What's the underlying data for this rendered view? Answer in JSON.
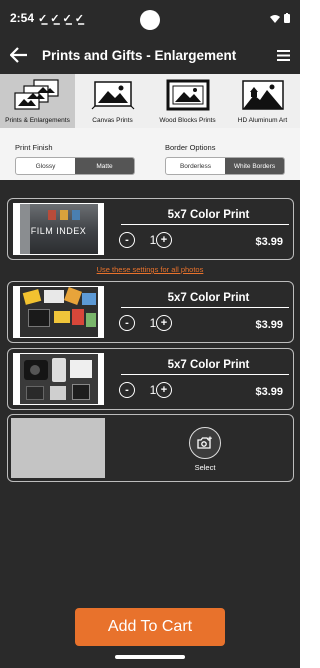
{
  "status": {
    "time": "2:54",
    "checks": [
      "✓̲",
      "✓̲",
      "✓̲",
      "✓̲"
    ],
    "signal_icon": "wifi-icon",
    "battery_icon": "battery-icon"
  },
  "appbar": {
    "title": "Prints and Gifts - Enlargement",
    "back_icon": "back-arrow-icon",
    "menu_icon": "hamburger-menu-icon"
  },
  "categories": [
    {
      "label": "Prints & Enlargements",
      "active": true
    },
    {
      "label": "Canvas Prints",
      "active": false
    },
    {
      "label": "Wood Blocks Prints",
      "active": false
    },
    {
      "label": "HD Aluminum Art",
      "active": false
    }
  ],
  "options": {
    "finish": {
      "title": "Print Finish",
      "choices": [
        "Glossy",
        "Matte"
      ],
      "selected": "Matte"
    },
    "border": {
      "title": "Border Options",
      "choices": [
        "Borderless",
        "White Borders"
      ],
      "selected": "White Borders"
    }
  },
  "products": [
    {
      "title": "5x7 Color Print",
      "quantity": "1",
      "price": "$3.99",
      "minus": "-",
      "plus": "+",
      "image_text": "FILM INDEX"
    },
    {
      "title": "5x7 Color Print",
      "quantity": "1",
      "price": "$3.99",
      "minus": "-",
      "plus": "+"
    },
    {
      "title": "5x7 Color Print",
      "quantity": "1",
      "price": "$3.99",
      "minus": "-",
      "plus": "+"
    }
  ],
  "settings_link": "Use these settings for all photos",
  "select": {
    "label": "Select",
    "icon": "add-photo-camera-icon"
  },
  "cart_button": "Add To Cart",
  "colors": {
    "accent": "#e8722c",
    "background": "#2a2a2a"
  }
}
